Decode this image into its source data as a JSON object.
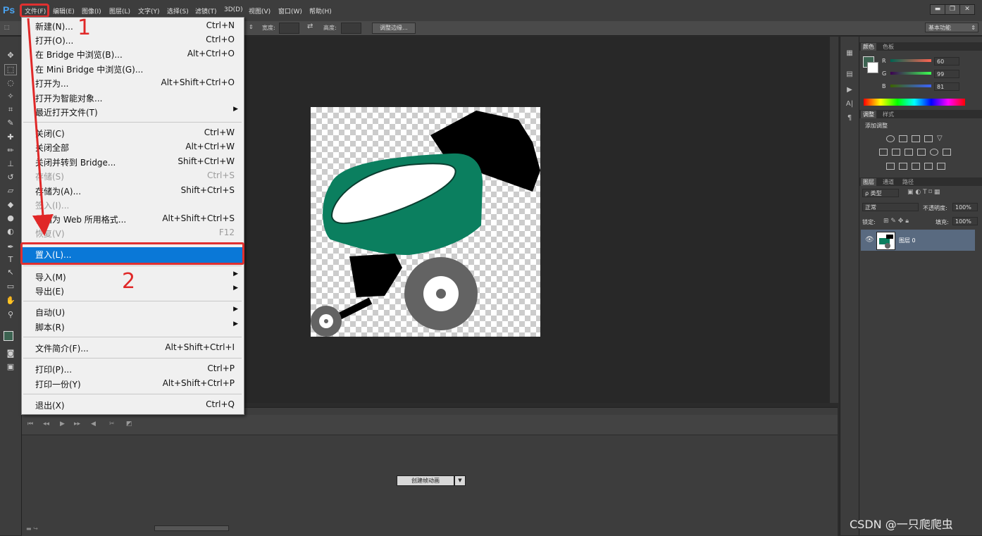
{
  "app": {
    "logo": "Ps"
  },
  "menubar": {
    "items": [
      "文件(F)",
      "编辑(E)",
      "图像(I)",
      "图层(L)",
      "文字(Y)",
      "选择(S)",
      "滤镜(T)",
      "3D(D)",
      "视图(V)",
      "窗口(W)",
      "帮助(H)"
    ]
  },
  "window_controls": {
    "minimize": "▬",
    "restore": "❐",
    "close": "✕"
  },
  "options_bar": {
    "width_label": "宽度:",
    "height_label": "高度:",
    "refine_edge_button": "调整边缘...",
    "workspace": "基本功能"
  },
  "file_menu": {
    "items": [
      {
        "label": "新建(N)...",
        "shortcut": "Ctrl+N"
      },
      {
        "label": "打开(O)...",
        "shortcut": "Ctrl+O"
      },
      {
        "label": "在 Bridge 中浏览(B)...",
        "shortcut": "Alt+Ctrl+O"
      },
      {
        "label": "在 Mini Bridge 中浏览(G)...",
        "shortcut": ""
      },
      {
        "label": "打开为...",
        "shortcut": "Alt+Shift+Ctrl+O"
      },
      {
        "label": "打开为智能对象...",
        "shortcut": ""
      },
      {
        "label": "最近打开文件(T)",
        "shortcut": ""
      },
      {
        "label": "关闭(C)",
        "shortcut": "Ctrl+W"
      },
      {
        "label": "关闭全部",
        "shortcut": "Alt+Ctrl+W"
      },
      {
        "label": "关闭并转到 Bridge...",
        "shortcut": "Shift+Ctrl+W"
      },
      {
        "label": "存储(S)",
        "shortcut": "Ctrl+S"
      },
      {
        "label": "存储为(A)...",
        "shortcut": "Shift+Ctrl+S"
      },
      {
        "label": "签入(I)...",
        "shortcut": ""
      },
      {
        "label": "存储为 Web 所用格式...",
        "shortcut": "Alt+Shift+Ctrl+S"
      },
      {
        "label": "恢复(V)",
        "shortcut": "F12"
      },
      {
        "label": "置入(L)...",
        "shortcut": ""
      },
      {
        "label": "导入(M)",
        "shortcut": ""
      },
      {
        "label": "导出(E)",
        "shortcut": ""
      },
      {
        "label": "自动(U)",
        "shortcut": ""
      },
      {
        "label": "脚本(R)",
        "shortcut": ""
      },
      {
        "label": "文件简介(F)...",
        "shortcut": "Alt+Shift+Ctrl+I"
      },
      {
        "label": "打印(P)...",
        "shortcut": "Ctrl+P"
      },
      {
        "label": "打印一份(Y)",
        "shortcut": "Alt+Shift+Ctrl+P"
      },
      {
        "label": "退出(X)",
        "shortcut": "Ctrl+Q"
      }
    ]
  },
  "annotations": {
    "step1": "1",
    "step2": "2"
  },
  "timeline": {
    "create_animation_button": "创建帧动画"
  },
  "color_panel": {
    "tabs": [
      "颜色",
      "色板"
    ],
    "r_label": "R",
    "g_label": "G",
    "b_label": "B",
    "r": "60",
    "g": "99",
    "b": "81",
    "foreground_color": "#3c6351"
  },
  "adjust_panel": {
    "tabs": [
      "调整",
      "样式"
    ],
    "title": "添加调整"
  },
  "layers_panel": {
    "tabs": [
      "图层",
      "通道",
      "路径"
    ],
    "filter_kind": "ρ 类型",
    "blend_mode": "正常",
    "opacity_label": "不透明度:",
    "opacity": "100%",
    "lock_label": "锁定:",
    "fill_label": "填充:",
    "fill": "100%",
    "layer_name": "图层 0"
  },
  "watermark": "CSDN @一只爬爬虫",
  "colors": {
    "accent_blue": "#0a78d7",
    "annotation_red": "#e03030",
    "car_green": "#0b7f5f"
  }
}
